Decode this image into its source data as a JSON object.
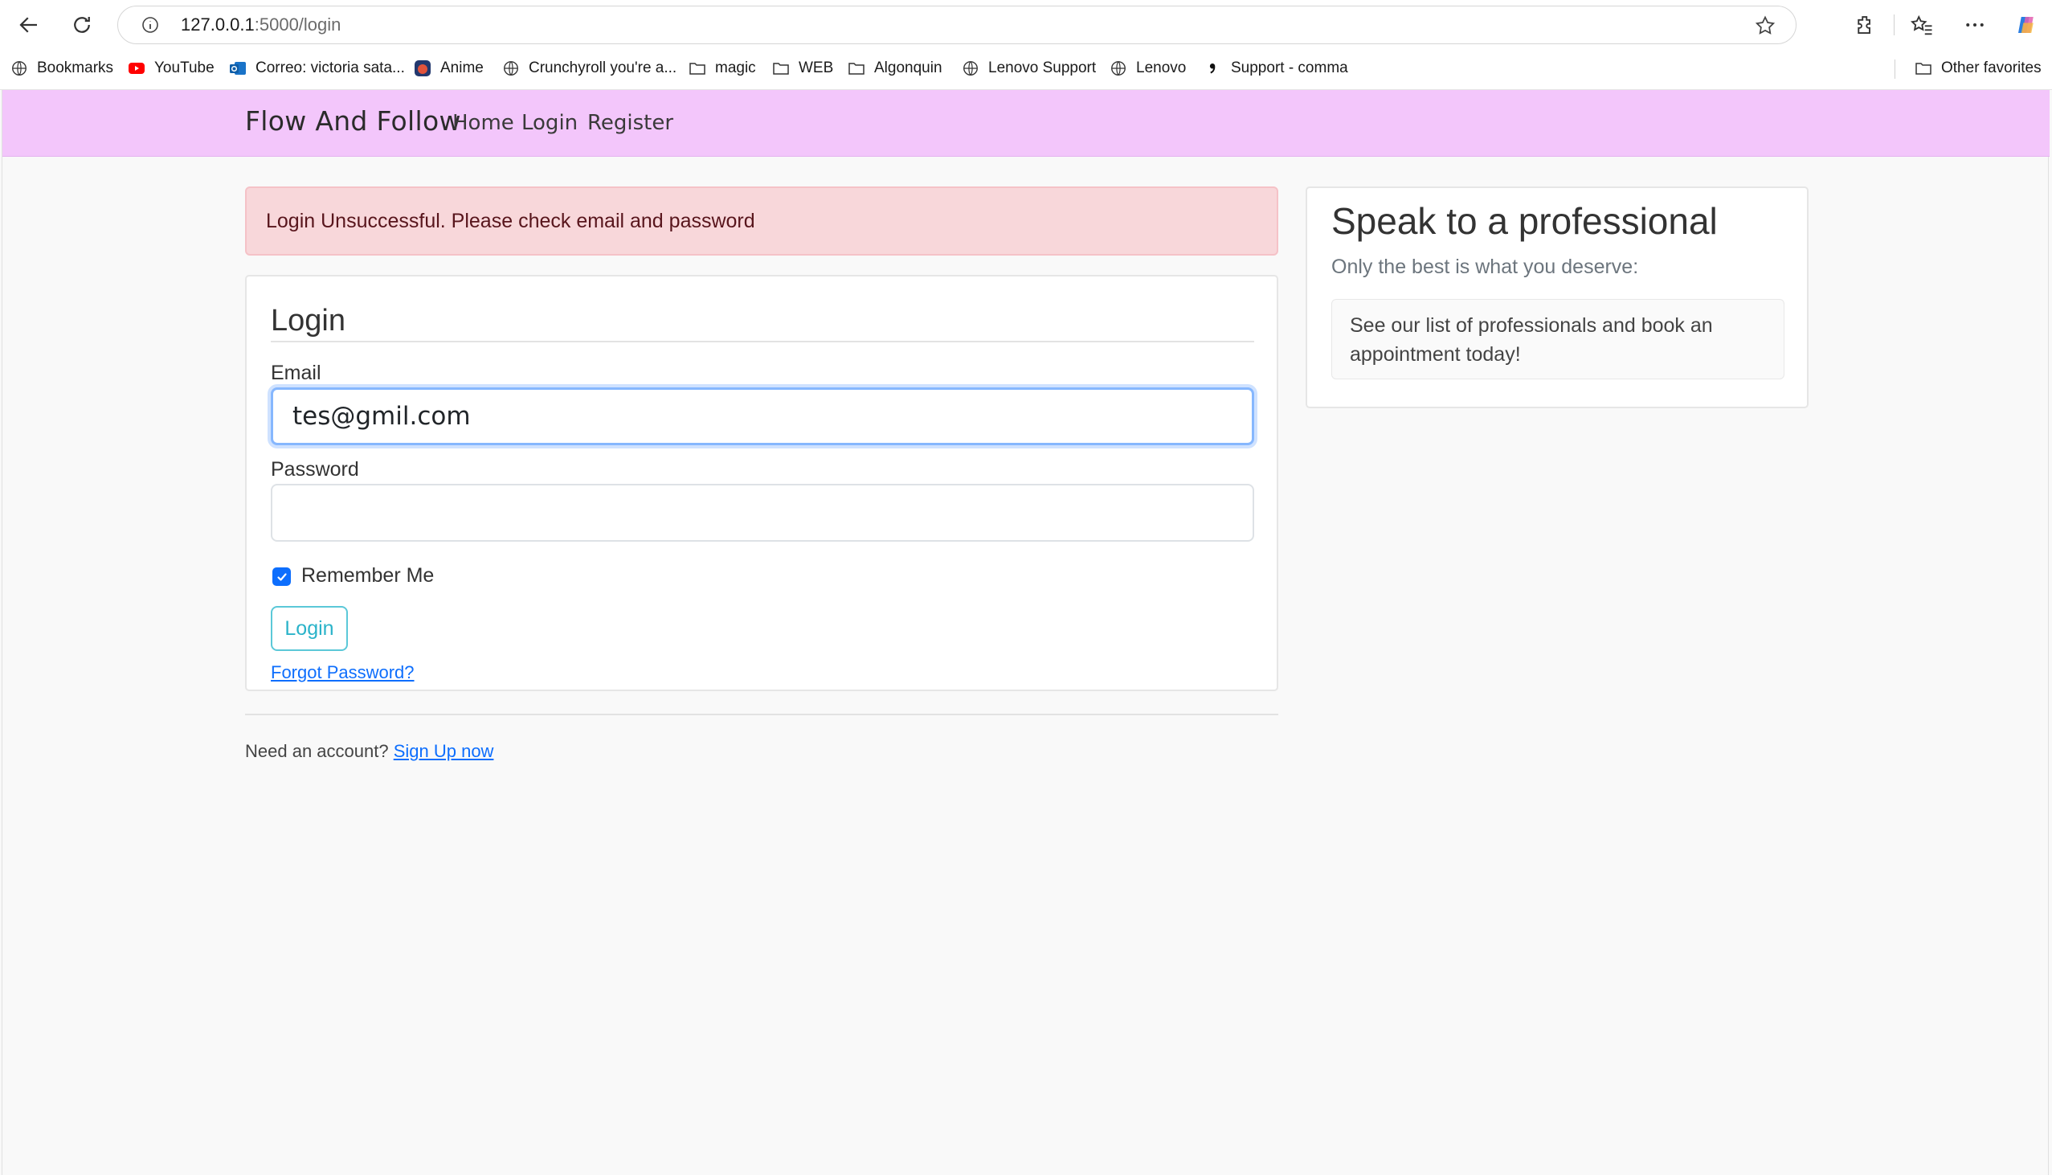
{
  "browser": {
    "url_host": "127.0.0.1",
    "url_path": ":5000/login",
    "bookmarks": [
      {
        "label": "Bookmarks",
        "icon": "globe-icon"
      },
      {
        "label": "YouTube",
        "icon": "youtube-icon"
      },
      {
        "label": "Correo: victoria sata...",
        "icon": "outlook-icon"
      },
      {
        "label": "Anime",
        "icon": "anime-icon"
      },
      {
        "label": "Crunchyroll you're a...",
        "icon": "globe-icon"
      },
      {
        "label": "magic",
        "icon": "folder-icon"
      },
      {
        "label": "WEB",
        "icon": "folder-icon"
      },
      {
        "label": "Algonquin",
        "icon": "folder-icon"
      },
      {
        "label": "Lenovo Support",
        "icon": "globe-icon"
      },
      {
        "label": "Lenovo",
        "icon": "globe-icon"
      },
      {
        "label": "Support - comma",
        "icon": "comma-icon"
      }
    ],
    "other_favorites": "Other favorites"
  },
  "navbar": {
    "brand": "Flow And Follow",
    "links": [
      "Home",
      "Login",
      "Register"
    ],
    "background": "#f3c6fb"
  },
  "alert": {
    "message": "Login Unsuccessful. Please check email and password",
    "type": "danger"
  },
  "login_form": {
    "legend": "Login",
    "email_label": "Email",
    "email_value": "tes@gmil.com",
    "password_label": "Password",
    "password_value": "",
    "remember_label": "Remember Me",
    "remember_checked": true,
    "submit_label": "Login",
    "forgot_label": "Forgot Password?"
  },
  "signup": {
    "text": "Need an account?",
    "link": "Sign Up now"
  },
  "sidebar": {
    "title": "Speak to a professional",
    "subtitle": "Only the best is what you deserve:",
    "item": "See our list of professionals and book an appointment today!"
  }
}
